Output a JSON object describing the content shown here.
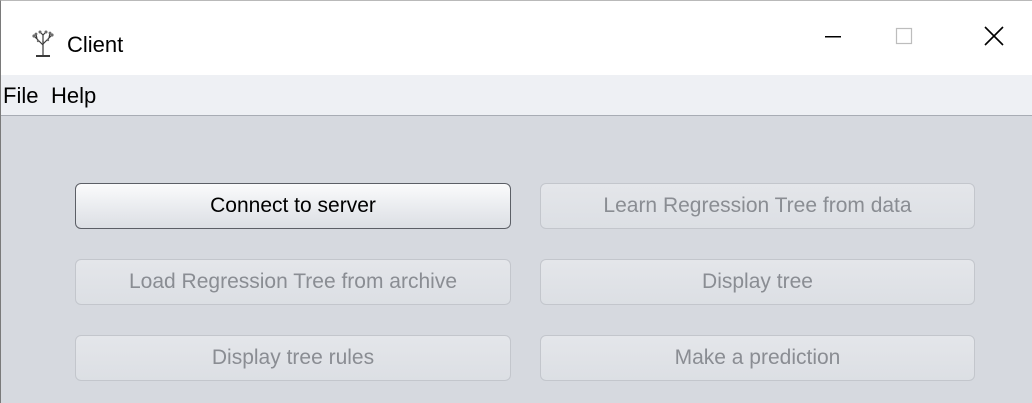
{
  "window": {
    "title": "Client",
    "icon": "tree-app-icon",
    "controls": {
      "minimize_icon": "minimize-icon",
      "maximize_icon": "maximize-icon",
      "close_icon": "close-icon"
    }
  },
  "menu": {
    "items": [
      {
        "label": "File"
      },
      {
        "label": "Help"
      }
    ]
  },
  "buttons": {
    "connect": {
      "label": "Connect to server",
      "enabled": true
    },
    "learn": {
      "label": "Learn Regression Tree from data",
      "enabled": false
    },
    "load": {
      "label": "Load Regression Tree from archive",
      "enabled": false
    },
    "display_tree": {
      "label": "Display tree",
      "enabled": false
    },
    "display_rules": {
      "label": "Display tree rules",
      "enabled": false
    },
    "predict": {
      "label": "Make a prediction",
      "enabled": false
    }
  },
  "colors": {
    "background": "#d6d9df",
    "menubar": "#eef0f4",
    "disabled_text": "#8a8d93",
    "enabled_text": "#000000"
  }
}
